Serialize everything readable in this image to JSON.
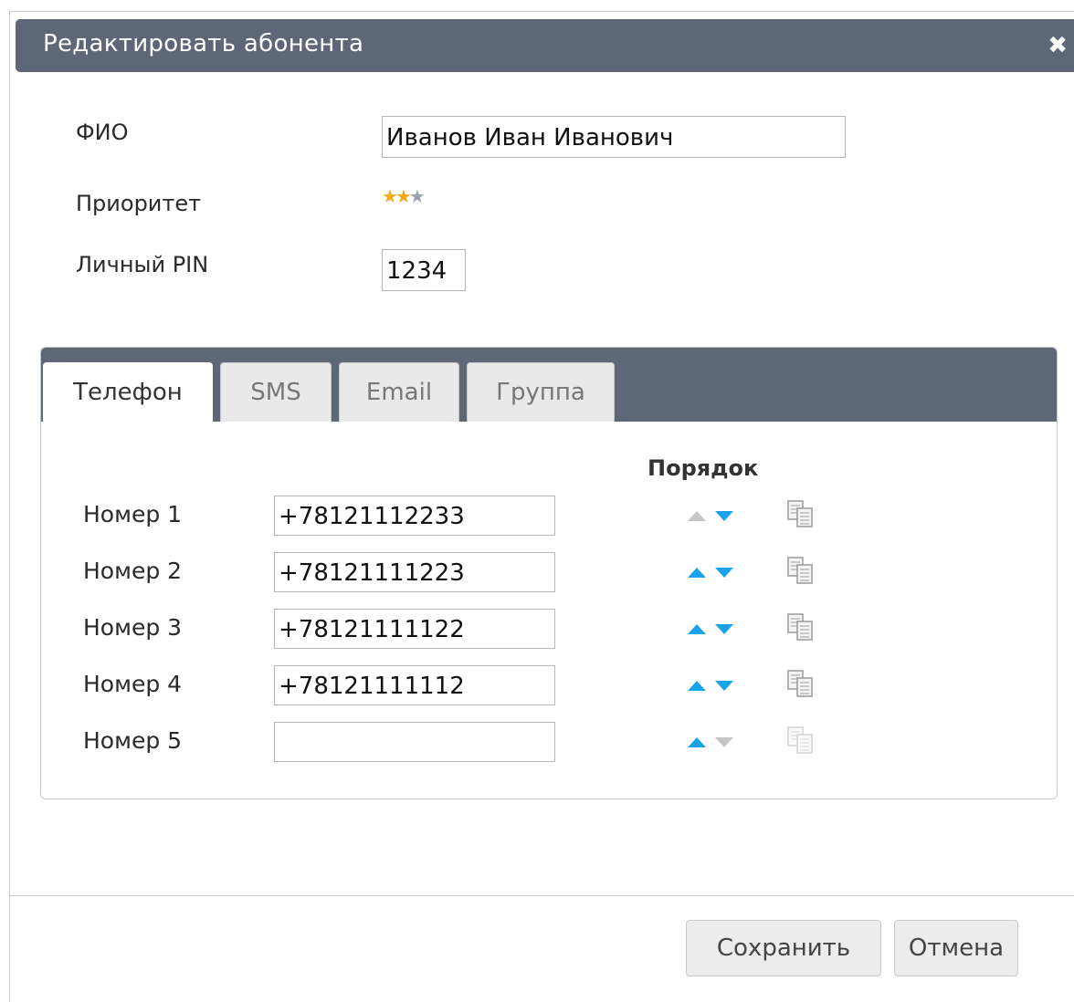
{
  "dialog": {
    "title": "Редактировать абонента",
    "close_glyph": "✖"
  },
  "form": {
    "fio_label": "ФИО",
    "fio_value": "Иванов Иван Иванович",
    "priority_label": "Приоритет",
    "priority_value": 2,
    "priority_max": 3,
    "pin_label": "Личный PIN",
    "pin_value": "1234"
  },
  "tabs": [
    {
      "label": "Телефон",
      "active": true
    },
    {
      "label": "SMS",
      "active": false
    },
    {
      "label": "Email",
      "active": false
    },
    {
      "label": "Группа",
      "active": false
    }
  ],
  "phone": {
    "order_header": "Порядок",
    "rows": [
      {
        "label": "Номер 1",
        "value": "+78121112233",
        "up_enabled": false,
        "down_enabled": true,
        "copy_enabled": true
      },
      {
        "label": "Номер 2",
        "value": "+78121111223",
        "up_enabled": true,
        "down_enabled": true,
        "copy_enabled": true
      },
      {
        "label": "Номер 3",
        "value": "+78121111122",
        "up_enabled": true,
        "down_enabled": true,
        "copy_enabled": true
      },
      {
        "label": "Номер 4",
        "value": "+78121111112",
        "up_enabled": true,
        "down_enabled": true,
        "copy_enabled": true
      },
      {
        "label": "Номер 5",
        "value": "",
        "up_enabled": true,
        "down_enabled": false,
        "copy_enabled": false
      }
    ]
  },
  "footer": {
    "save_label": "Сохранить",
    "cancel_label": "Отмена"
  },
  "colors": {
    "header_bg": "#5d6776",
    "arrow_active": "#1aa3e8",
    "arrow_inactive": "#c6c6c6",
    "star_on": "#f0a91b",
    "star_off": "#9aa3ad"
  }
}
